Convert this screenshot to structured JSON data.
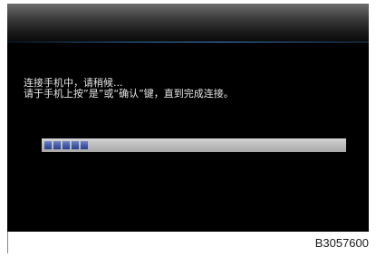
{
  "dialog": {
    "message_line1": "连接手机中，请稍候...",
    "message_line2": "请于手机上按”是”或“确认”键，直到完成连接。"
  },
  "progress": {
    "segments_filled": 5
  },
  "figure": {
    "code": "B3057600"
  },
  "colors": {
    "screen_background": "#000000",
    "text": "#e6e6e6",
    "progress_track": "#bdbdbd",
    "progress_segment": "#3f56a8",
    "title_bar_accent": "#3d86c6"
  }
}
